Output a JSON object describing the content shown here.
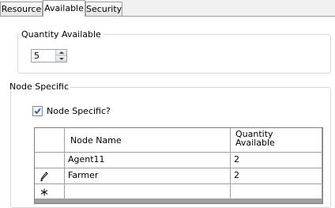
{
  "tabs": [
    {
      "label": "Resource",
      "active": false
    },
    {
      "label": "Available",
      "active": true
    },
    {
      "label": "Security",
      "active": false
    }
  ],
  "quantity_group": {
    "legend": "Quantity Available",
    "spinner_value": "5"
  },
  "node_group": {
    "legend": "Node Specific",
    "checkbox_label": "Node Specific?",
    "checkbox_checked": true
  },
  "grid": {
    "columns": [
      "Node Name",
      "Quantity\nAvailable"
    ],
    "rows": [
      {
        "node_name": "Agent11",
        "quantity": "2"
      },
      {
        "node_name": "Farmer",
        "quantity": "2"
      }
    ],
    "row_indicators": [
      "",
      "edit-pencil-icon",
      "new-row-asterisk-icon"
    ]
  },
  "colors": {
    "checkbox_accent": "#2a5ca8",
    "border": "#a0a0a0",
    "footer_bar": "#a0a0a0"
  }
}
